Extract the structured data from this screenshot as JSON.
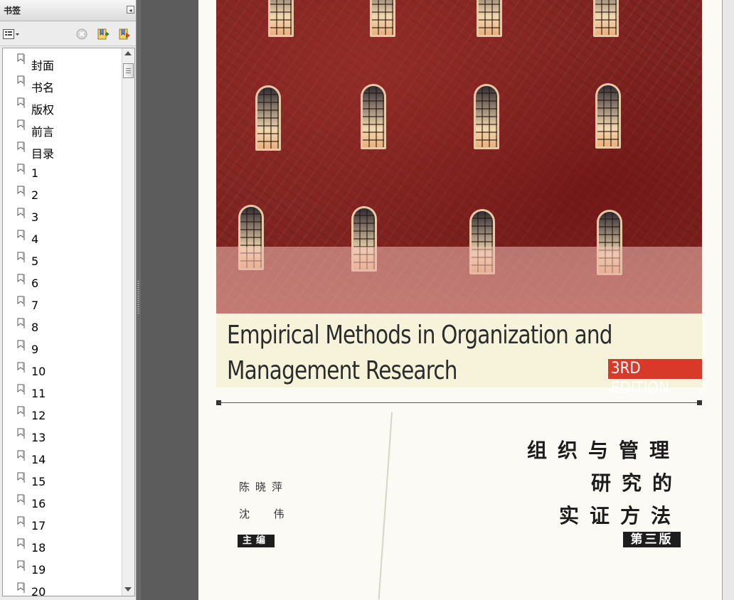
{
  "panel": {
    "title": "书签",
    "bookmarks": [
      "封面",
      "书名",
      "版权",
      "前言",
      "目录",
      "1",
      "2",
      "3",
      "4",
      "5",
      "6",
      "7",
      "8",
      "9",
      "10",
      "11",
      "12",
      "13",
      "14",
      "15",
      "16",
      "17",
      "18",
      "19",
      "20"
    ]
  },
  "cover": {
    "title_en": "Empirical Methods in Organization and\nManagement Research",
    "edition_en": "3RD EDITION",
    "title_zh_line1": "组织与管理",
    "title_zh_line2": "研究的",
    "title_zh_line3": "实证方法",
    "edition_zh": "第三版",
    "editor_1": "陈晓萍",
    "editor_2": "沈  伟",
    "editor_role": "主编"
  },
  "colors": {
    "cover_red": "#7e2320",
    "edition_red": "#d73a29",
    "title_band": "#f7f3da"
  }
}
